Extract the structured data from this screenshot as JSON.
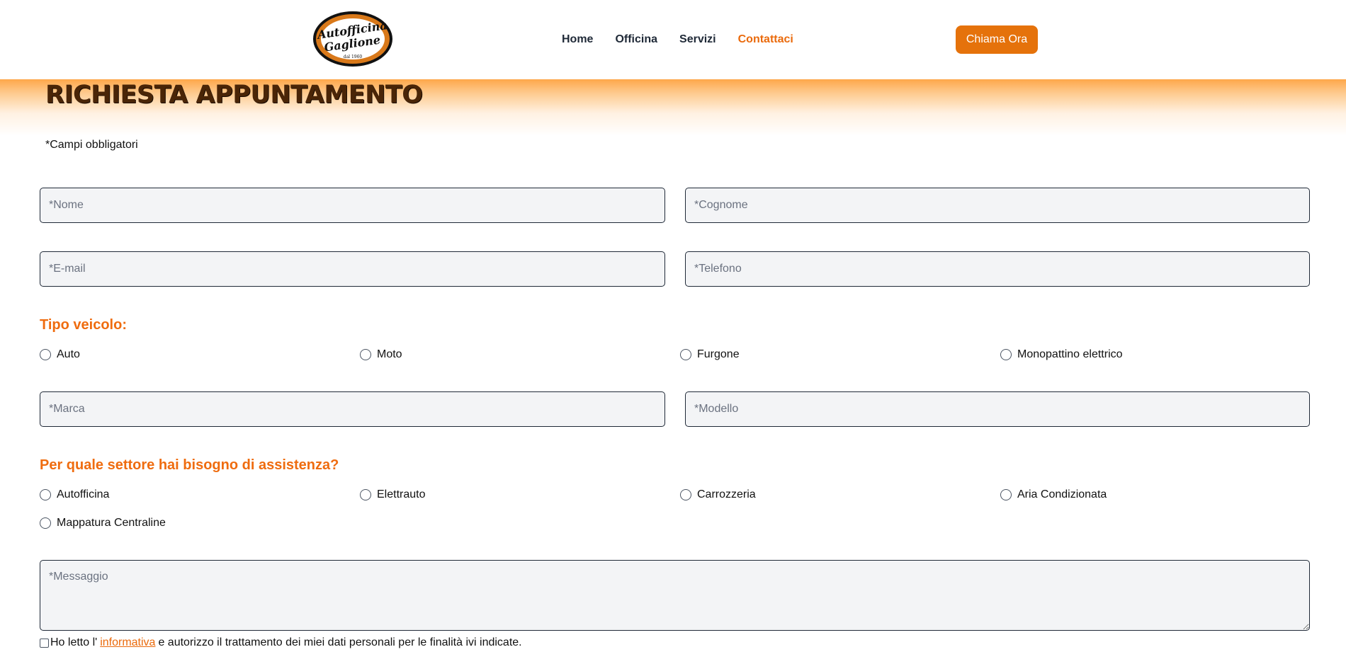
{
  "header": {
    "logo_text": "Autofficina Gaglione",
    "logo_subtext": "dal 1960",
    "nav": [
      {
        "label": "Home"
      },
      {
        "label": "Officina"
      },
      {
        "label": "Servizi"
      },
      {
        "label": "Contattaci",
        "active": true
      }
    ],
    "cta_label": "Chiama Ora"
  },
  "colors": {
    "accent": "#e5720b",
    "title": "#4a2507",
    "section_label": "#ef6c0f"
  },
  "form": {
    "title": "RICHIESTA APPUNTAMENTO",
    "required_note": "*Campi obbligatori",
    "fields": {
      "nome": {
        "placeholder": "*Nome",
        "value": ""
      },
      "cognome": {
        "placeholder": "*Cognome",
        "value": ""
      },
      "email": {
        "placeholder": "*E-mail",
        "value": ""
      },
      "telefono": {
        "placeholder": "*Telefono",
        "value": ""
      },
      "marca": {
        "placeholder": "*Marca",
        "value": ""
      },
      "modello": {
        "placeholder": "*Modello",
        "value": ""
      },
      "messaggio": {
        "placeholder": "*Messaggio",
        "value": ""
      }
    },
    "vehicle_type": {
      "label": "Tipo veicolo:",
      "options": [
        "Auto",
        "Moto",
        "Furgone",
        "Monopattino elettrico"
      ]
    },
    "sector": {
      "label": "Per quale settore hai bisogno di assistenza?",
      "options": [
        "Autofficina",
        "Elettrauto",
        "Carrozzeria",
        "Aria Condizionata",
        "Mappatura Centraline"
      ]
    },
    "consent": {
      "prefix": "Ho letto l'",
      "link": "informativa",
      "suffix": "e autorizzo il trattamento dei miei dati personali per le finalità ivi indicate."
    }
  }
}
